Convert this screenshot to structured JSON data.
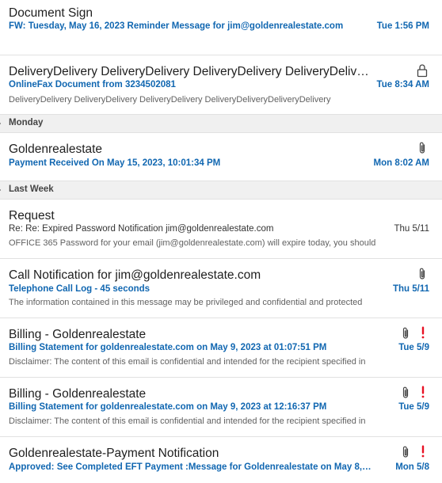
{
  "messages": [
    {
      "sender": "Document Sign",
      "subject": "FW: Tuesday, May 16, 2023 Reminder Message for jim@goldenrealestate.com",
      "date": "Tue 1:56 PM"
    },
    {
      "sender": "DeliveryDelivery DeliveryDelivery DeliveryDelivery DeliveryDelivery",
      "subject": "OnlineFax Document from 3234502081",
      "preview": "DeliveryDelivery DeliveryDelivery DeliveryDelivery DeliveryDeliveryDeliveryDelivery",
      "date": "Tue 8:34 AM",
      "icon": "lock-icon"
    }
  ],
  "groups": {
    "monday": "Monday",
    "last_week": "Last Week"
  },
  "monday_messages": [
    {
      "sender": "Goldenrealestate",
      "subject": "Payment Received On May 15, 2023, 10:01:34 PM",
      "date": "Mon 8:02 AM",
      "icon": "paperclip-icon"
    }
  ],
  "last_week_messages": [
    {
      "sender": "Request",
      "subject": "Re: Re: Expired Password Notification  jim@goldenrealestate.com",
      "preview": "OFFICE 365   Password for your email (jim@goldenrealestate.com) will expire today, you should",
      "date": "Thu 5/11"
    },
    {
      "sender": "Call Notification for jim@goldenrealestate.com",
      "subject": "Telephone Call Log - 45 seconds",
      "preview": "The information contained in this message may be privileged and confidential and protected",
      "date": "Thu 5/11",
      "icon": "paperclip-icon"
    },
    {
      "sender": "Billing - Goldenrealestate",
      "subject": "Billing Statement for goldenrealestate.com on May 9, 2023 at 01:07:51 PM",
      "preview": "Disclaimer: The content of this email is confidential and intended for the recipient specified in",
      "date": "Tue 5/9",
      "icon": "paperclip-icon",
      "flag": "high-importance-icon"
    },
    {
      "sender": "Billing - Goldenrealestate",
      "subject": "Billing Statement for goldenrealestate.com on May 9, 2023 at 12:16:37 PM",
      "preview": "Disclaimer: The content of this email is confidential and intended for the recipient specified in",
      "date": "Tue 5/9",
      "icon": "paperclip-icon",
      "flag": "high-importance-icon"
    },
    {
      "sender": "Goldenrealestate-Payment Notification",
      "subject": "Approved: See Completed EFT Payment :Message for Goldenrealestate on May 8, 2023,...",
      "date": "Mon 5/8",
      "icon": "paperclip-icon",
      "flag": "high-importance-icon"
    }
  ],
  "colors": {
    "accent": "#1167b1",
    "importance": "#e81123",
    "group_bg": "#f0f0f0"
  }
}
